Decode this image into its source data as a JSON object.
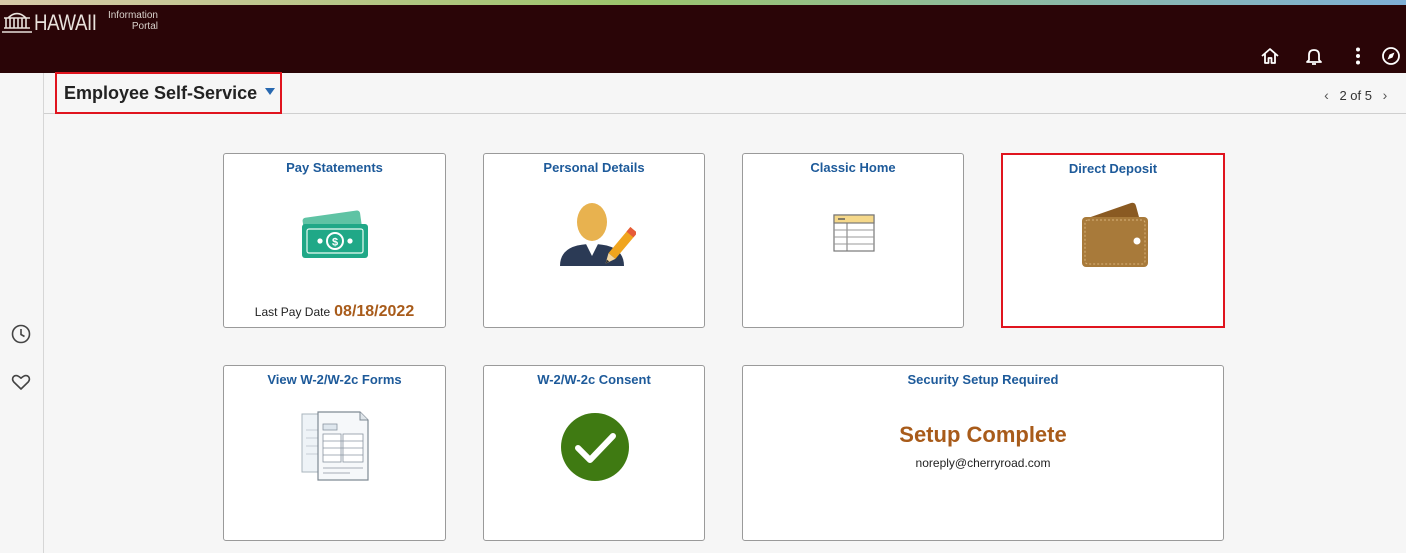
{
  "brand": {
    "name": "HAWAII",
    "sub_line1": "Information",
    "sub_line2": "Portal"
  },
  "header_icons": [
    "home-icon",
    "bell-icon",
    "more-vertical-icon",
    "navbar-compass-icon"
  ],
  "homepage": {
    "title": "Employee Self-Service",
    "page_label": "2 of 5"
  },
  "rail_icons": [
    "recent-clock-icon",
    "favorites-heart-icon"
  ],
  "tiles": {
    "pay_statements": {
      "title": "Pay Statements",
      "last_pay_label": "Last Pay Date",
      "last_pay_value": "08/18/2022"
    },
    "personal_details": {
      "title": "Personal Details"
    },
    "classic_home": {
      "title": "Classic Home"
    },
    "direct_deposit": {
      "title": "Direct Deposit"
    },
    "w2_forms": {
      "title": "View W-2/W-2c Forms"
    },
    "w2_consent": {
      "title": "W-2/W-2c Consent"
    },
    "security_setup": {
      "title": "Security Setup Required",
      "status": "Setup Complete",
      "email": "noreply@cherryroad.com"
    }
  },
  "colors": {
    "header_bg": "#2a0507",
    "tile_title": "#1d5a9a",
    "accent_orange": "#a85b1a",
    "highlight_red": "#e0141e",
    "consent_green": "#3f7a12",
    "wallet_brown": "#a87a3a"
  }
}
